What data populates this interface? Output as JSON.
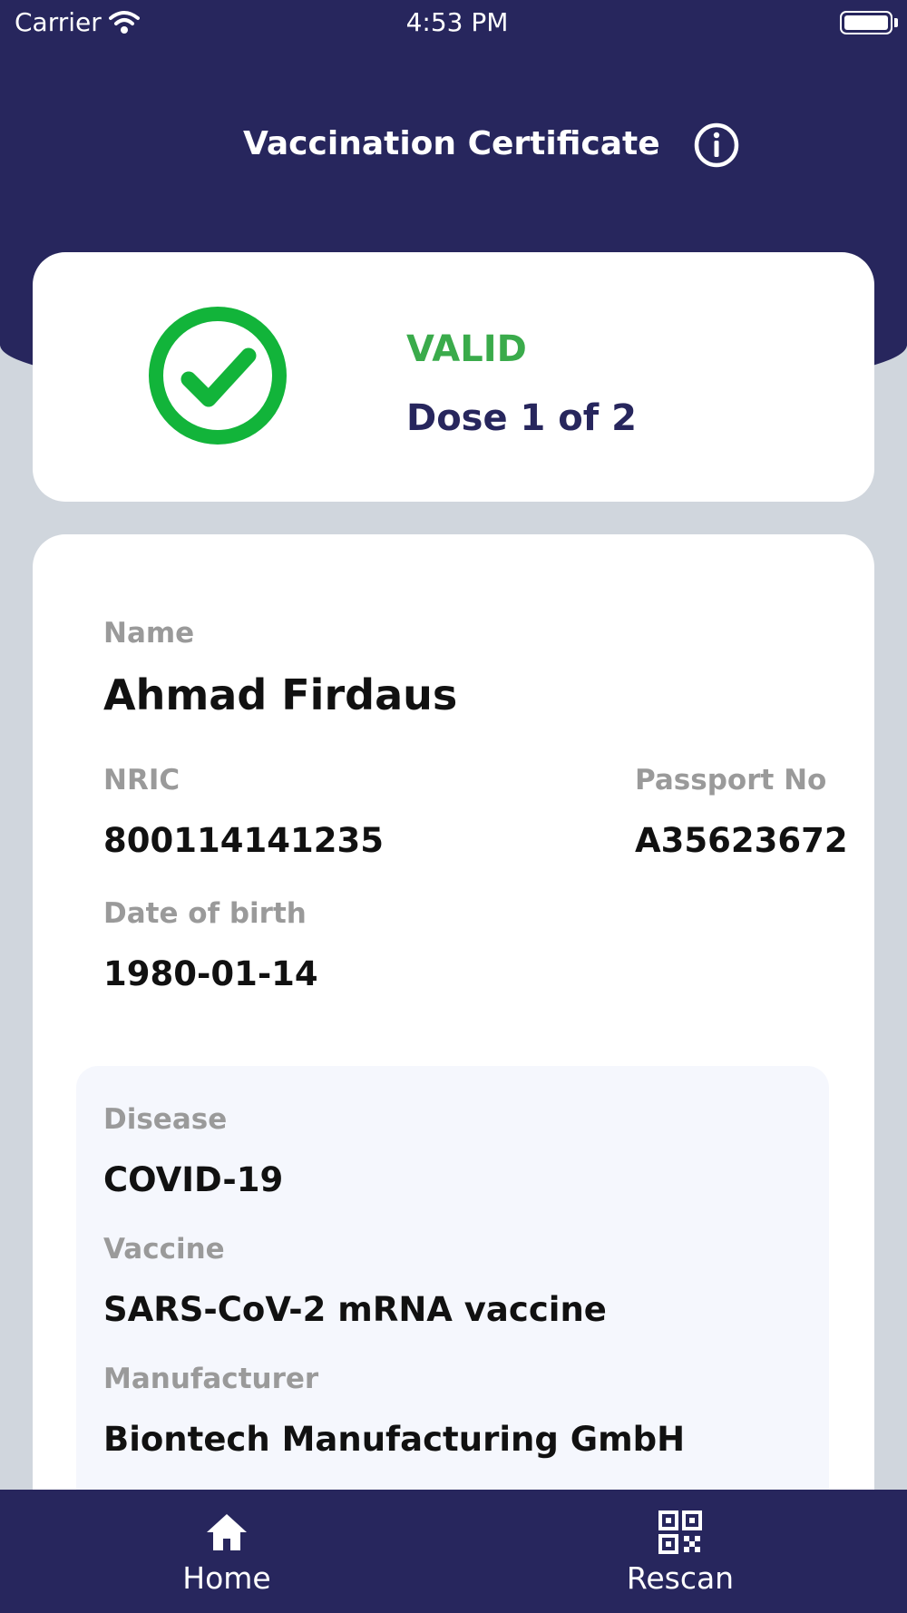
{
  "status_bar": {
    "carrier": "Carrier",
    "time": "4:53 PM"
  },
  "header": {
    "title": "Vaccination Certificate",
    "info_icon": "info-icon"
  },
  "status_card": {
    "status": "VALID",
    "dose": "Dose 1 of 2",
    "icon": "check-circle-icon"
  },
  "person": {
    "name_label": "Name",
    "name": "Ahmad Firdaus",
    "nric_label": "NRIC",
    "nric": "800114141235",
    "passport_label": "Passport No",
    "passport": "A35623672",
    "dob_label": "Date of birth",
    "dob": "1980-01-14"
  },
  "vaccination": {
    "disease_label": "Disease",
    "disease": "COVID-19",
    "vaccine_label": "Vaccine",
    "vaccine": "SARS-CoV-2 mRNA vaccine",
    "manufacturer_label": "Manufacturer",
    "manufacturer": "Biontech Manufacturing GmbH"
  },
  "bottom_nav": {
    "items": [
      {
        "label": "Home",
        "icon": "home-icon"
      },
      {
        "label": "Rescan",
        "icon": "qr-code-icon"
      }
    ]
  },
  "colors": {
    "primary": "#27265d",
    "valid_green": "#3aab4b",
    "check_green": "#12b43a",
    "background": "#d0d6dd",
    "label_gray": "#9a9a9a"
  }
}
